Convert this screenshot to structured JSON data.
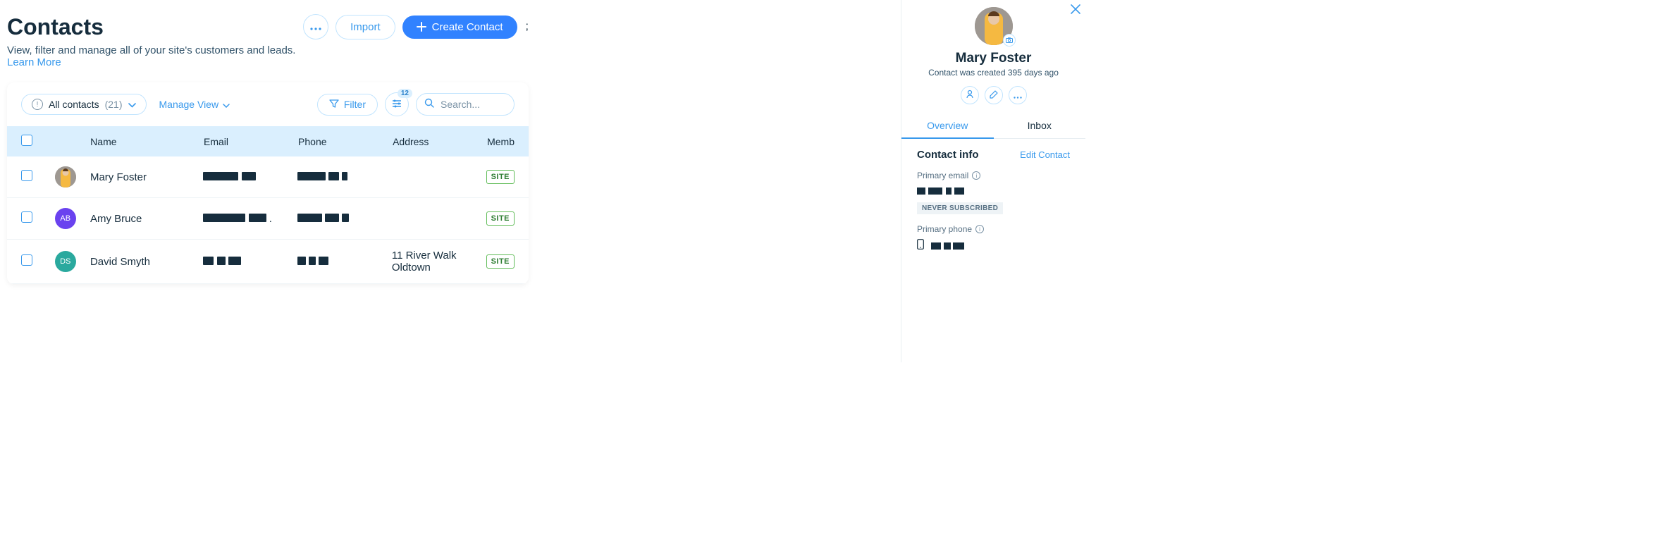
{
  "header": {
    "title": "Contacts",
    "subtitle": "View, filter and manage all of your site's customers and leads. ",
    "learn_more": "Learn More",
    "import_btn": "Import",
    "create_btn": "Create Contact"
  },
  "toolbar": {
    "filter_chip_label": "All contacts",
    "filter_chip_count": "(21)",
    "manage_view": "Manage View",
    "filter_btn": "Filter",
    "settings_badge": "12",
    "search_placeholder": "Search..."
  },
  "table": {
    "headers": {
      "name": "Name",
      "email": "Email",
      "phone": "Phone",
      "address": "Address",
      "member": "Memb"
    },
    "rows": [
      {
        "name": "Mary Foster",
        "avatar_type": "img",
        "avatar_initials": "",
        "address": "",
        "badge": "SITE"
      },
      {
        "name": "Amy Bruce",
        "avatar_type": "purple",
        "avatar_initials": "AB",
        "address": "",
        "badge": "SITE"
      },
      {
        "name": "David Smyth",
        "avatar_type": "teal",
        "avatar_initials": "DS",
        "address": "11 River Walk Oldtown",
        "badge": "SITE"
      }
    ]
  },
  "panel": {
    "name": "Mary Foster",
    "subtext": "Contact was created 395 days ago",
    "tabs": {
      "overview": "Overview",
      "inbox": "Inbox"
    },
    "section_title": "Contact info",
    "edit_label": "Edit Contact",
    "primary_email_label": "Primary email",
    "never_subscribed": "NEVER SUBSCRIBED",
    "primary_phone_label": "Primary phone"
  }
}
